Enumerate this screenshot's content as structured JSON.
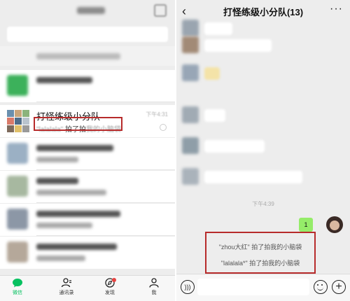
{
  "left": {
    "group_chat": {
      "name": "打怪练级小分队",
      "time": "下午4:31",
      "preview_user": "\"lalalala\"",
      "preview_action": " 拍了拍",
      "preview_target": "我的小脑袋"
    },
    "tabs": [
      {
        "label": "微信",
        "icon": "chat-icon"
      },
      {
        "label": "通讯录",
        "icon": "contacts-icon"
      },
      {
        "label": "发现",
        "icon": "discover-icon"
      },
      {
        "label": "我",
        "icon": "me-icon"
      }
    ]
  },
  "right": {
    "title": "打怪练级小分队(13)",
    "back": "‹",
    "more": "···",
    "time": "下午4:39",
    "my_message": "1",
    "pat_notices": [
      "\"zhou大红\" 拍了拍我的小脑袋",
      "\"lalalala*\" 拍了拍我的小脑袋"
    ]
  },
  "colors": {
    "highlight": "#b72b2b",
    "wechat_green": "#07c160",
    "bubble_green": "#95ec69"
  }
}
